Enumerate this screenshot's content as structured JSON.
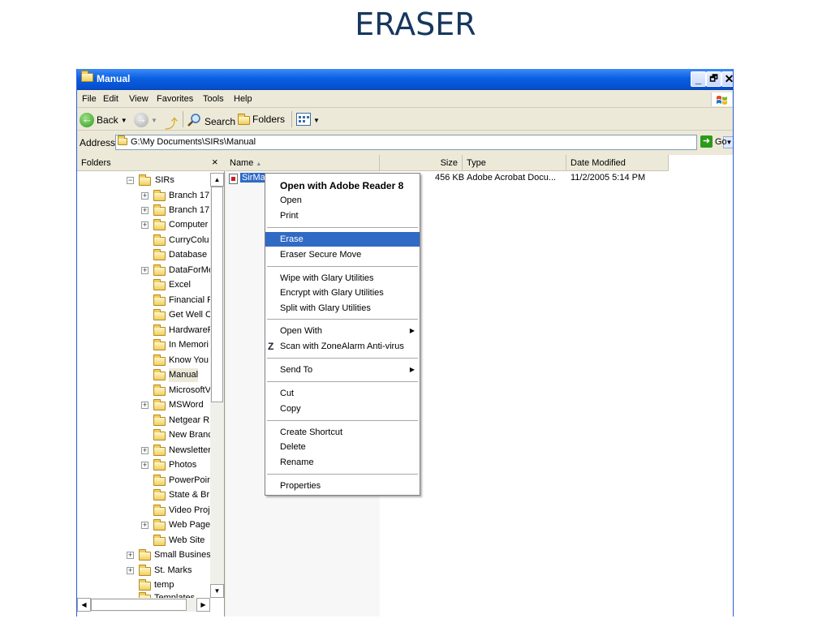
{
  "slide": {
    "title": "ERASER"
  },
  "window": {
    "title": "Manual",
    "controls": {
      "minimize": "_",
      "maximize": "🗗",
      "close": "✕"
    }
  },
  "menubar": {
    "items": [
      "File",
      "Edit",
      "View",
      "Favorites",
      "Tools",
      "Help"
    ]
  },
  "toolbar": {
    "back": "Back",
    "search": "Search",
    "folders": "Folders"
  },
  "address": {
    "label": "Address",
    "path": "G:\\My Documents\\SIRs\\Manual",
    "go": "Go"
  },
  "folders_pane": {
    "title": "Folders",
    "close": "×",
    "items": [
      {
        "label": "SIRs",
        "expander": "−"
      },
      {
        "label": "Branch 17",
        "expander": "+"
      },
      {
        "label": "Branch 17",
        "expander": "+"
      },
      {
        "label": "Computer",
        "expander": "+"
      },
      {
        "label": "CurryColu",
        "expander": ""
      },
      {
        "label": "Database",
        "expander": ""
      },
      {
        "label": "DataForMe",
        "expander": "+"
      },
      {
        "label": "Excel",
        "expander": ""
      },
      {
        "label": "Financial R",
        "expander": ""
      },
      {
        "label": "Get Well C",
        "expander": ""
      },
      {
        "label": "HardwareF",
        "expander": ""
      },
      {
        "label": "In Memori",
        "expander": ""
      },
      {
        "label": "Know You",
        "expander": ""
      },
      {
        "label": "Manual",
        "expander": "",
        "selected": true
      },
      {
        "label": "MicrosoftV",
        "expander": ""
      },
      {
        "label": "MSWord",
        "expander": "+"
      },
      {
        "label": "Netgear R",
        "expander": ""
      },
      {
        "label": "New Branc",
        "expander": ""
      },
      {
        "label": "Newsletter",
        "expander": "+"
      },
      {
        "label": "Photos",
        "expander": "+"
      },
      {
        "label": "PowerPoir",
        "expander": ""
      },
      {
        "label": "State & Br",
        "expander": ""
      },
      {
        "label": "Video Proj",
        "expander": ""
      },
      {
        "label": "Web Page",
        "expander": "+"
      },
      {
        "label": "Web Site",
        "expander": ""
      },
      {
        "label": "Small Business",
        "expander": "+"
      },
      {
        "label": "St. Marks",
        "expander": "+"
      },
      {
        "label": "temp",
        "expander": ""
      },
      {
        "label": "Templates",
        "expander": ""
      }
    ]
  },
  "file_list": {
    "columns": {
      "name": "Name",
      "size": "Size",
      "type": "Type",
      "date": "Date Modified"
    },
    "rows": [
      {
        "name": "SirManual.pdf",
        "size": "456 KB",
        "type": "Adobe Acrobat Docu...",
        "date": "11/2/2005 5:14 PM"
      }
    ]
  },
  "context_menu": {
    "groups": [
      [
        "Open with Adobe Reader 8",
        "Open",
        "Print"
      ],
      [
        "Erase",
        "Eraser Secure Move"
      ],
      [
        "Wipe with Glary Utilities",
        "Encrypt with Glary Utilities",
        "Split with Glary Utilities"
      ],
      [
        "Open With",
        "Scan with ZoneAlarm Anti-virus"
      ],
      [
        "Send To"
      ],
      [
        "Cut",
        "Copy"
      ],
      [
        "Create Shortcut",
        "Delete",
        "Rename"
      ],
      [
        "Properties"
      ]
    ],
    "zonealarm_icon": "Z",
    "highlighted": "Erase"
  }
}
